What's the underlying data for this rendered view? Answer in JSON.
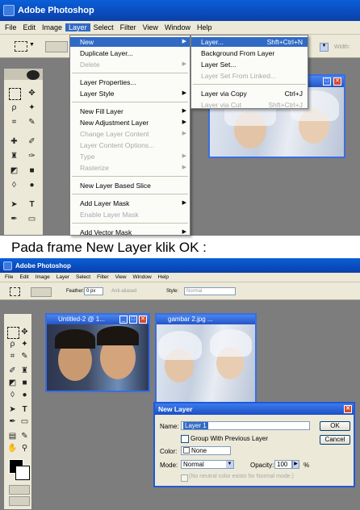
{
  "top": {
    "window_title": "Adobe Photoshop",
    "menus": [
      "File",
      "Edit",
      "Image",
      "Layer",
      "Select",
      "Filter",
      "View",
      "Window",
      "Help"
    ],
    "active_menu": "Layer",
    "option_hint": "Width:",
    "layer_menu": [
      {
        "label": "New",
        "sub": true,
        "state": "selected"
      },
      {
        "label": "Duplicate Layer..."
      },
      {
        "label": "Delete",
        "sub": true,
        "state": "disabled"
      },
      {
        "label": "Layer Properties..."
      },
      {
        "label": "Layer Style",
        "sub": true
      },
      {
        "label": "New Fill Layer",
        "sub": true
      },
      {
        "label": "New Adjustment Layer",
        "sub": true
      },
      {
        "label": "Change Layer Content",
        "sub": true,
        "state": "disabled"
      },
      {
        "label": "Layer Content Options...",
        "state": "disabled"
      },
      {
        "label": "Type",
        "sub": true,
        "state": "disabled"
      },
      {
        "label": "Rasterize",
        "sub": true,
        "state": "disabled"
      },
      {
        "label": "New Layer Based Slice"
      },
      {
        "label": "Add Layer Mask",
        "sub": true
      },
      {
        "label": "Enable Layer Mask",
        "state": "disabled"
      },
      {
        "label": "Add Vector Mask",
        "sub": true
      }
    ],
    "new_submenu": [
      {
        "label": "Layer...",
        "shortcut": "Shft+Ctrl+N",
        "state": "selected"
      },
      {
        "label": "Background From Layer",
        "shortcut": ""
      },
      {
        "label": "Layer Set...",
        "shortcut": ""
      },
      {
        "label": "Layer Set From Linked...",
        "shortcut": "",
        "state": "disabled"
      },
      {
        "label": "Layer via Copy",
        "shortcut": "Ctrl+J"
      },
      {
        "label": "Layer via Cut",
        "shortcut": "Shft+Ctrl+J",
        "state": "disabled"
      }
    ]
  },
  "caption": "Pada frame New Layer klik OK :",
  "bottom": {
    "window_title": "Adobe Photoshop",
    "menus": [
      "File",
      "Edit",
      "Image",
      "Layer",
      "Select",
      "Filter",
      "View",
      "Window",
      "Help"
    ],
    "feather_label": "Feather:",
    "feather_value": "0 px",
    "antialias_label": "Anti-aliased",
    "style_label": "Style:",
    "style_value": "Normal",
    "doc1_title": "Untitled-2 @ 1...",
    "doc2_title": "gambar 2.jpg ...",
    "dialog": {
      "title": "New Layer",
      "name_label": "Name:",
      "name_value": "Layer 1",
      "group_label": "Group With Previous Layer",
      "color_label": "Color:",
      "color_value": "None",
      "mode_label": "Mode:",
      "mode_value": "Normal",
      "opacity_label": "Opacity:",
      "opacity_value": "100",
      "opacity_unit": "%",
      "neutral_label": "(No neutral color exists for Normal mode.)",
      "ok_label": "OK",
      "cancel_label": "Cancel"
    }
  },
  "colors": {
    "titlebar": "#0b4fc4",
    "menu_highlight": "#316ac5",
    "workspace": "#7d7d7d",
    "xp_face": "#ece9d8"
  }
}
